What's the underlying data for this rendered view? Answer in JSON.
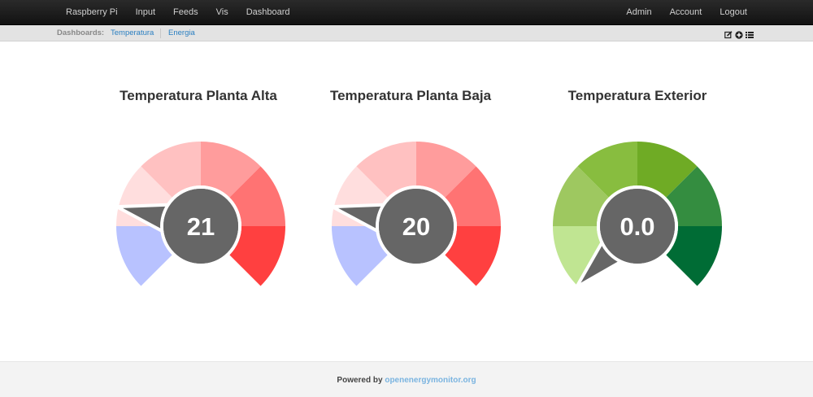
{
  "nav": {
    "left": [
      "Raspberry Pi",
      "Input",
      "Feeds",
      "Vis",
      "Dashboard"
    ],
    "right": [
      "Admin",
      "Account",
      "Logout"
    ]
  },
  "subbar": {
    "label": "Dashboards:",
    "links": [
      "Temperatura",
      "Energia"
    ],
    "icons": [
      "edit-icon",
      "add-icon",
      "list-icon"
    ]
  },
  "gauges": [
    {
      "title": "Temperatura Planta Alta",
      "value": "21",
      "colors": [
        "#b8c2ff",
        "#ffdede",
        "#ffc1c1",
        "#ff9c9c",
        "#ff7373",
        "#ff4040"
      ]
    },
    {
      "title": "Temperatura Planta Baja",
      "value": "20",
      "colors": [
        "#b8c2ff",
        "#ffdede",
        "#ffc1c1",
        "#ff9c9c",
        "#ff7373",
        "#ff4040"
      ]
    },
    {
      "title": "Temperatura Exterior",
      "value": "0.0",
      "colors": [
        "#c0e592",
        "#9ec860",
        "#88bd3f",
        "#6fab25",
        "#348d40",
        "#006c35"
      ]
    }
  ],
  "footer": {
    "powered_by": "Powered by",
    "link": "openenergymonitor.org"
  },
  "theme": {
    "navbar": "#1b1b1b",
    "link": "#2a7fc1",
    "hub": "#666666"
  }
}
